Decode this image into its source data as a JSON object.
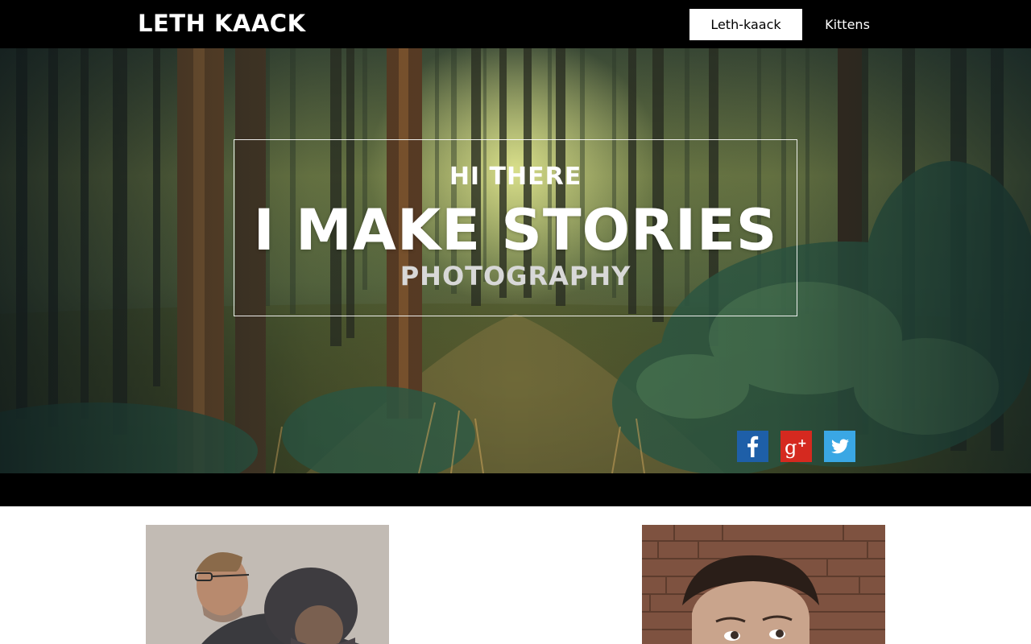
{
  "site": {
    "brand": "LETH KAACK"
  },
  "nav": {
    "items": [
      {
        "label": "Leth-kaack",
        "active": true
      },
      {
        "label": "Kittens",
        "active": false
      }
    ]
  },
  "hero": {
    "kicker": "HI THERE",
    "title": "I MAKE STORIES",
    "subtitle": "PHOTOGRAPHY",
    "social": [
      {
        "icon": "facebook-icon",
        "color": "#1e5fa8"
      },
      {
        "icon": "google-plus-icon",
        "color": "#d5291f"
      },
      {
        "icon": "twitter-icon",
        "color": "#3aa7e4"
      }
    ]
  },
  "gallery": {
    "items": [
      {
        "subject": "man-embracing-child-photo"
      },
      {
        "subject": "man-portrait-brick-wall-photo"
      }
    ]
  },
  "colors": {
    "nav_background": "#000000",
    "nav_text": "#ffffff",
    "active_tab_background": "#ffffff",
    "band": "#000000"
  }
}
